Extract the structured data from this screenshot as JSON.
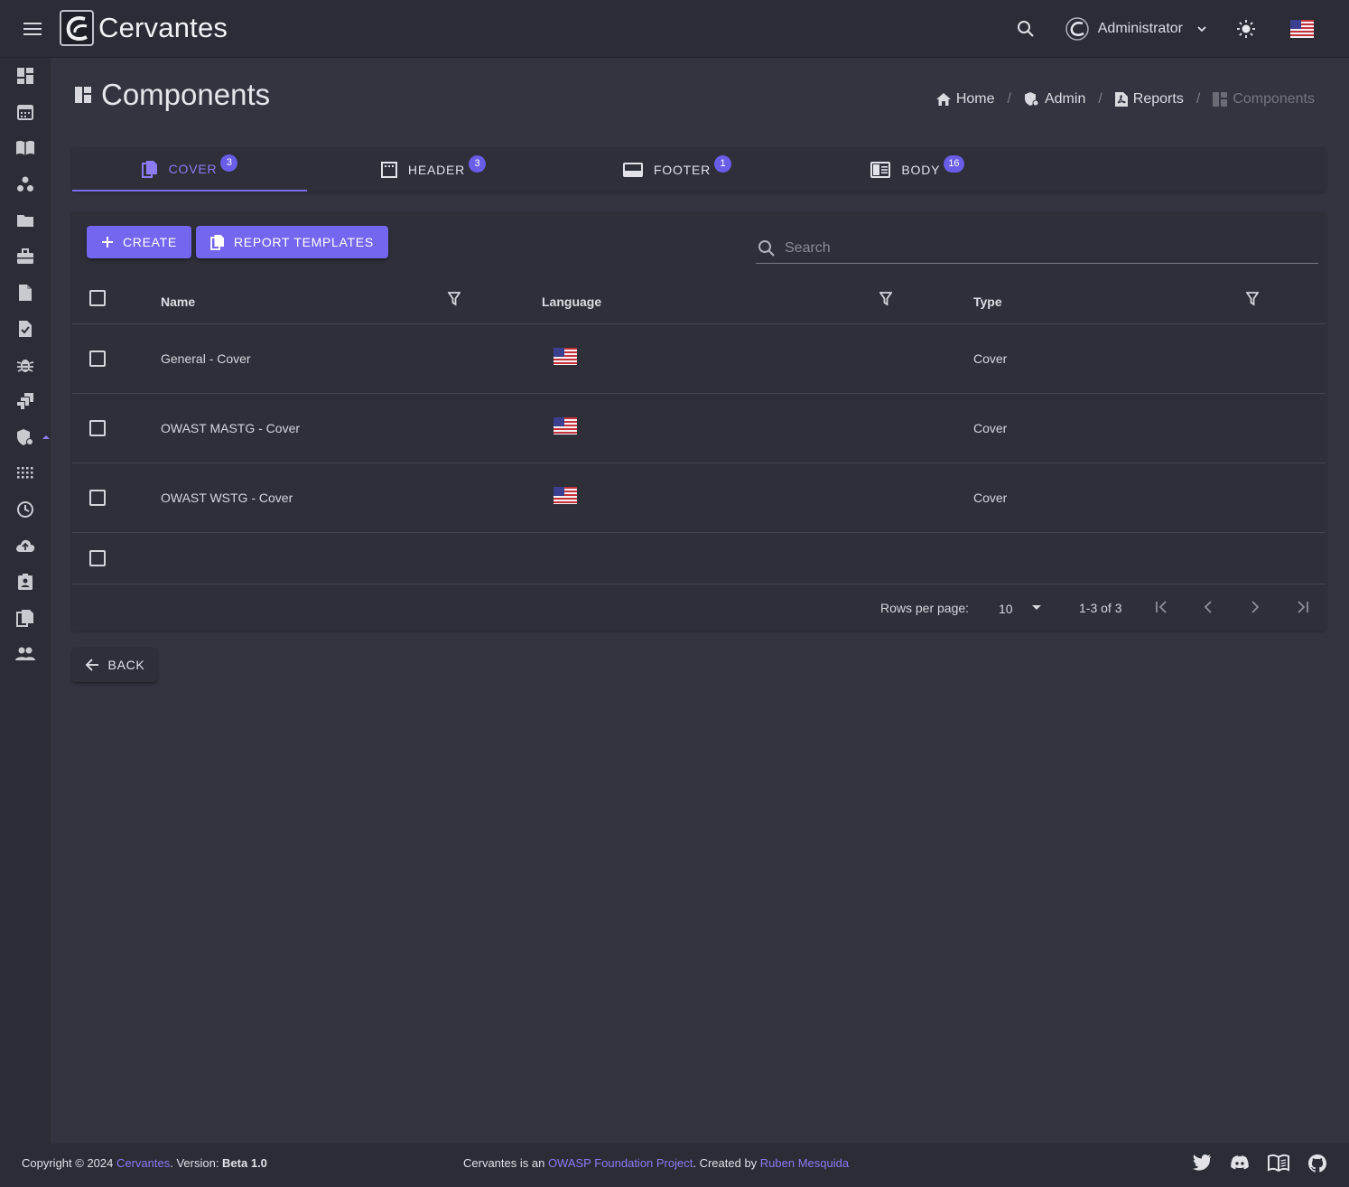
{
  "app": {
    "title": "Cervantes"
  },
  "header": {
    "user_name": "Administrator"
  },
  "page": {
    "title": "Components"
  },
  "breadcrumb": {
    "home": "Home",
    "admin": "Admin",
    "reports": "Reports",
    "current": "Components",
    "sep": "/"
  },
  "tabs": [
    {
      "label": "COVER",
      "count": "3"
    },
    {
      "label": "HEADER",
      "count": "3"
    },
    {
      "label": "FOOTER",
      "count": "1"
    },
    {
      "label": "BODY",
      "count": "16"
    }
  ],
  "toolbar": {
    "create_label": "CREATE",
    "templates_label": "REPORT TEMPLATES"
  },
  "search": {
    "placeholder": "Search"
  },
  "table": {
    "columns": [
      "Name",
      "Language",
      "Type"
    ],
    "rows": [
      {
        "name": "General - Cover",
        "language": "us-flag",
        "type": "Cover"
      },
      {
        "name": "OWAST MASTG - Cover",
        "language": "us-flag",
        "type": "Cover"
      },
      {
        "name": "OWAST WSTG - Cover",
        "language": "us-flag",
        "type": "Cover"
      }
    ]
  },
  "pagination": {
    "rows_per_page_label": "Rows per page:",
    "rows_per_page": "10",
    "range": "1-3 of 3"
  },
  "back_label": "BACK",
  "footer": {
    "copyright": "Copyright © 2024 ",
    "brand_link": "Cervantes",
    "version_text": ". Version: ",
    "version": "Beta 1.0",
    "project_text": "Cervantes is an ",
    "owasp_link": "OWASP Foundation Project",
    "created_text": ". Created by ",
    "author_link": "Ruben Mesquida"
  },
  "colors": {
    "accent": "#7466ee",
    "accent_text": "#8b7cf6",
    "background": "#33343f",
    "surface": "#2e2f39",
    "appbar": "#2b2c35"
  }
}
